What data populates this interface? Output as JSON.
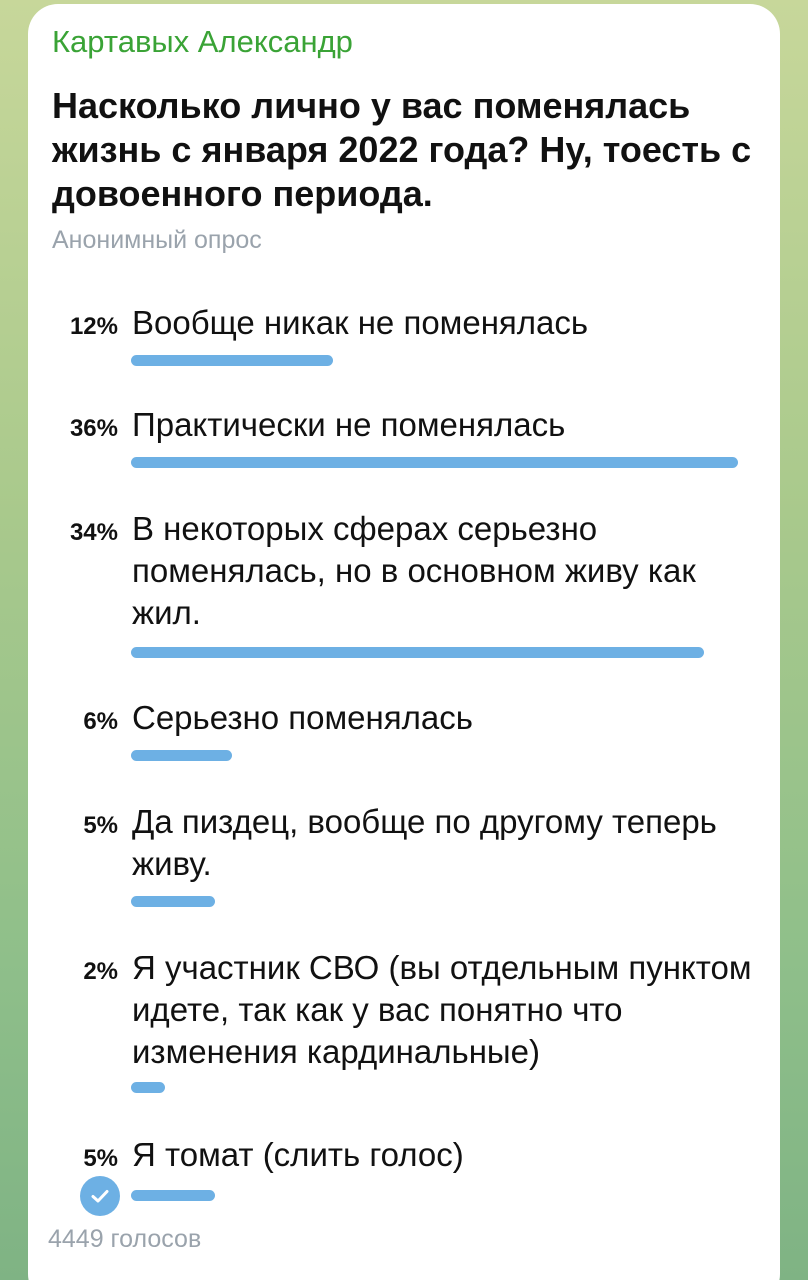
{
  "message": {
    "author": "Картавых Александр",
    "question": "Насколько лично у вас поменялась жизнь с января 2022 года? Ну, тоесть с довоенного периода.",
    "poll_type": "Анонимный опрос",
    "total_votes": "4449 голосов"
  },
  "poll": {
    "options": [
      {
        "percent_label": "12%",
        "text": "Вообще никак не поменялась",
        "percent": 12
      },
      {
        "percent_label": "36%",
        "text": "Практически не поменялась",
        "percent": 36
      },
      {
        "percent_label": "34%",
        "text": "В некоторых сферах серьезно поменялась, но в основном живу как жил.",
        "percent": 34
      },
      {
        "percent_label": "6%",
        "text": "Серьезно поменялась",
        "percent": 6
      },
      {
        "percent_label": "5%",
        "text": "Да пиздец, вообще по другому теперь живу.",
        "percent": 5
      },
      {
        "percent_label": "2%",
        "text": "Я участник СВО (вы отдельным пунктом идете, так как у вас понятно что изменения кардинальные)",
        "percent": 2
      },
      {
        "percent_label": "5%",
        "text": "Я томат (слить голос)",
        "percent": 5,
        "selected": true
      }
    ]
  },
  "colors": {
    "author": "#3aa336",
    "bar": "#6db0e4",
    "muted": "#9aa3ac"
  },
  "icons": {
    "selected": "check-circle-icon"
  }
}
